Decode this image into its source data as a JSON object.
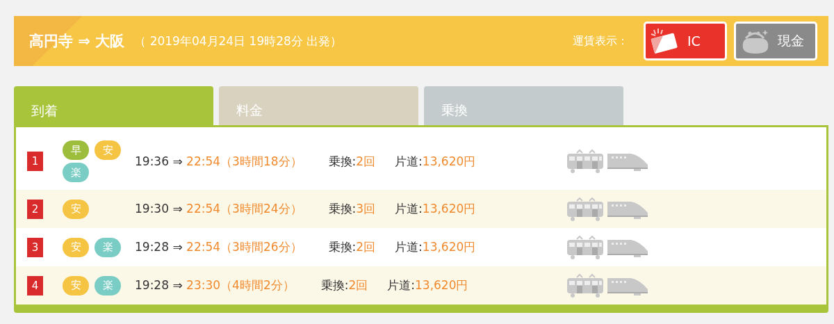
{
  "header": {
    "from": "高円寺",
    "arrow": "⇒",
    "to": "大阪",
    "departure": "（ 2019年04月24日 19時28分 出発）",
    "fare_label": "運賃表示：",
    "fare_buttons": [
      {
        "kind": "ic",
        "label": "IC",
        "selected": true
      },
      {
        "kind": "cash",
        "label": "現金",
        "selected": false
      }
    ]
  },
  "tabs": [
    {
      "label": "到着",
      "selected": true,
      "color": "#a8c43a"
    },
    {
      "label": "料金",
      "selected": false,
      "color": "#d8d2bf"
    },
    {
      "label": "乗換",
      "selected": false,
      "color": "#c4cbcc"
    }
  ],
  "routes": [
    {
      "rank": "1",
      "badges": [
        {
          "label": "早",
          "color": "#9dbd3c"
        },
        {
          "label": "安",
          "color": "#f5c443"
        },
        {
          "label": "楽",
          "color": "#7acdc4"
        }
      ],
      "depart": "19:36",
      "arrow": "⇒",
      "arrive": "22:54",
      "duration": "（3時間18分）",
      "transfer_label": "乗換:",
      "transfers": "2回",
      "fare_label": "片道:",
      "fare": "13,620円"
    },
    {
      "rank": "2",
      "badges": [
        {
          "label": "安",
          "color": "#f5c443"
        }
      ],
      "depart": "19:30",
      "arrow": "⇒",
      "arrive": "22:54",
      "duration": "（3時間24分）",
      "transfer_label": "乗換:",
      "transfers": "3回",
      "fare_label": "片道:",
      "fare": "13,620円"
    },
    {
      "rank": "3",
      "badges": [
        {
          "label": "安",
          "color": "#f5c443"
        },
        {
          "label": "楽",
          "color": "#7acdc4"
        }
      ],
      "depart": "19:28",
      "arrow": "⇒",
      "arrive": "22:54",
      "duration": "（3時間26分）",
      "transfer_label": "乗換:",
      "transfers": "2回",
      "fare_label": "片道:",
      "fare": "13,620円"
    },
    {
      "rank": "4",
      "badges": [
        {
          "label": "安",
          "color": "#f5c443"
        },
        {
          "label": "楽",
          "color": "#7acdc4"
        }
      ],
      "depart": "19:28",
      "arrow": "⇒",
      "arrive": "23:30",
      "duration": "（4時間2分）",
      "transfer_label": "乗換:",
      "transfers": "2回",
      "fare_label": "片道:",
      "fare": "13,620円"
    }
  ]
}
